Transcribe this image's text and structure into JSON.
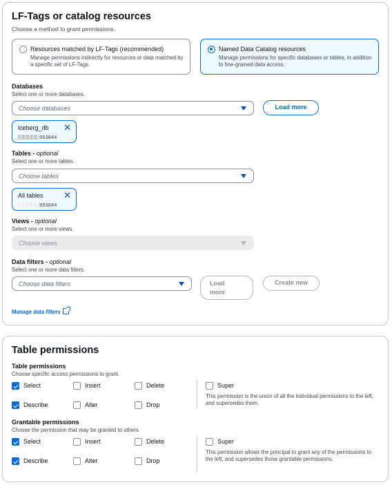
{
  "resources": {
    "title": "LF-Tags or catalog resources",
    "subtitle": "Choose a method to grant permissions.",
    "option_lftags": {
      "label": "Resources matched by LF-Tags (recommended)",
      "desc": "Manage permissions indirectly for resources or data matched by a specific set of LF-Tags.",
      "selected": false
    },
    "option_named": {
      "label": "Named Data Catalog resources",
      "desc": "Manage permissions for specific databases or tables, in addition to fine-grained data access.",
      "selected": true
    },
    "databases": {
      "label": "Databases",
      "sublabel": "Select one or more databases.",
      "placeholder": "Choose databases",
      "load_more": "Load more",
      "token": {
        "name": "iceberg_db",
        "account": "893844"
      }
    },
    "tables": {
      "label": "Tables",
      "optional": "optional",
      "sublabel": "Select one or more tables.",
      "placeholder": "Choose tables",
      "token": {
        "name": "All tables",
        "account": "893844"
      }
    },
    "views": {
      "label": "Views",
      "optional": "optional",
      "sublabel": "Select one or more views.",
      "placeholder": "Choose views"
    },
    "data_filters": {
      "label": "Data filters",
      "optional": "optional",
      "sublabel": "Select one or more data filters.",
      "placeholder": "Choose data filters",
      "load_more_line1": "Load",
      "load_more_line2": "more",
      "create_new": "Create new"
    },
    "manage_link": "Manage data filters",
    "dash": " - "
  },
  "table_permissions": {
    "title": "Table permissions",
    "perms": {
      "label": "Table permissions",
      "sublabel": "Choose specific access permissions to grant.",
      "select": "Select",
      "insert": "Insert",
      "delete": "Delete",
      "super": "Super",
      "describe": "Describe",
      "alter": "Alter",
      "drop": "Drop",
      "super_desc": "This permission is the union of all the individual permissions to the left, and supersedes them."
    },
    "grantable": {
      "label": "Grantable permissions",
      "sublabel": "Choose the permission that may be granted to others.",
      "select": "Select",
      "insert": "Insert",
      "delete": "Delete",
      "super": "Super",
      "describe": "Describe",
      "alter": "Alter",
      "drop": "Drop",
      "super_desc": "This permission allows the principal to grant any of the permissions to the left, and supersedes those grantable permissions."
    }
  },
  "icons": {
    "caret": "caret-down-icon",
    "remove": "close-icon",
    "external": "external-link-icon",
    "check": "check-icon"
  },
  "colors": {
    "accent": "#006ce0",
    "border": "#8c8c94",
    "selected_bg": "#f0fbff"
  }
}
